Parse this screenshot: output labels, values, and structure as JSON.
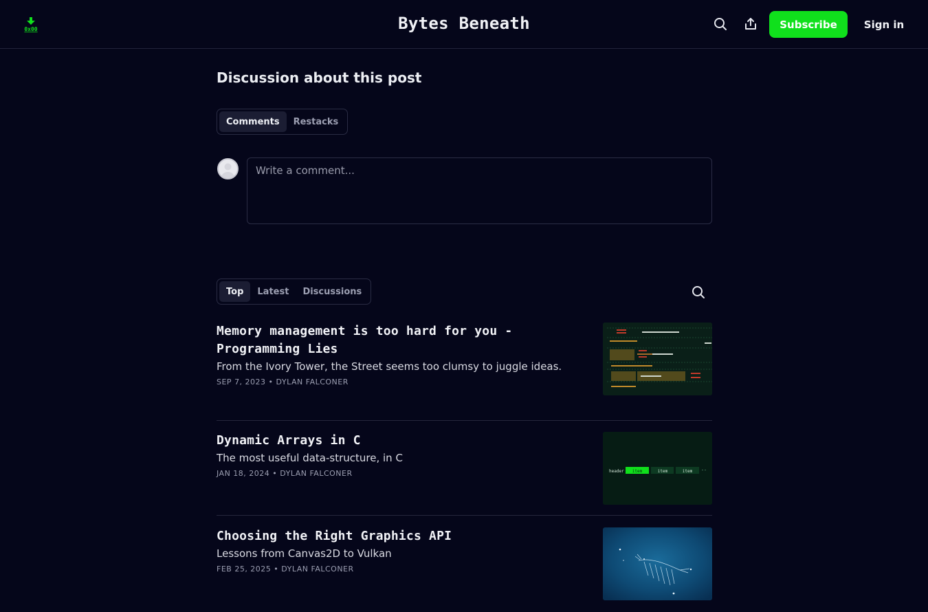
{
  "header": {
    "logo_text": "0x00",
    "site_title": "Bytes Beneath",
    "search_icon": "search-icon",
    "share_icon": "share-icon",
    "subscribe_label": "Subscribe",
    "signin_label": "Sign in"
  },
  "discussion": {
    "title": "Discussion about this post",
    "tabs": [
      "Comments",
      "Restacks"
    ],
    "active_tab": "Comments",
    "comment_placeholder": "Write a comment..."
  },
  "posts_section": {
    "tabs": [
      "Top",
      "Latest",
      "Discussions"
    ],
    "active_tab": "Top",
    "search_icon": "search-icon"
  },
  "posts": [
    {
      "title": "Memory management is too hard for you - Programming Lies",
      "subtitle": "From the Ivory Tower, the Street seems too clumsy to juggle ideas.",
      "meta": "SEP 7, 2023 • DYLAN FALCONER"
    },
    {
      "title": "Dynamic Arrays in C",
      "subtitle": "The most useful data-structure, in C",
      "meta": "JAN 18, 2024 • DYLAN FALCONER",
      "thumb_labels": [
        "header",
        "item",
        "item",
        "item"
      ]
    },
    {
      "title": "Choosing the Right Graphics API",
      "subtitle": "Lessons from Canvas2D to Vulkan",
      "meta": "FEB 25, 2025 • DYLAN FALCONER"
    }
  ],
  "colors": {
    "background": "#05061a",
    "accent": "#10e01c"
  }
}
